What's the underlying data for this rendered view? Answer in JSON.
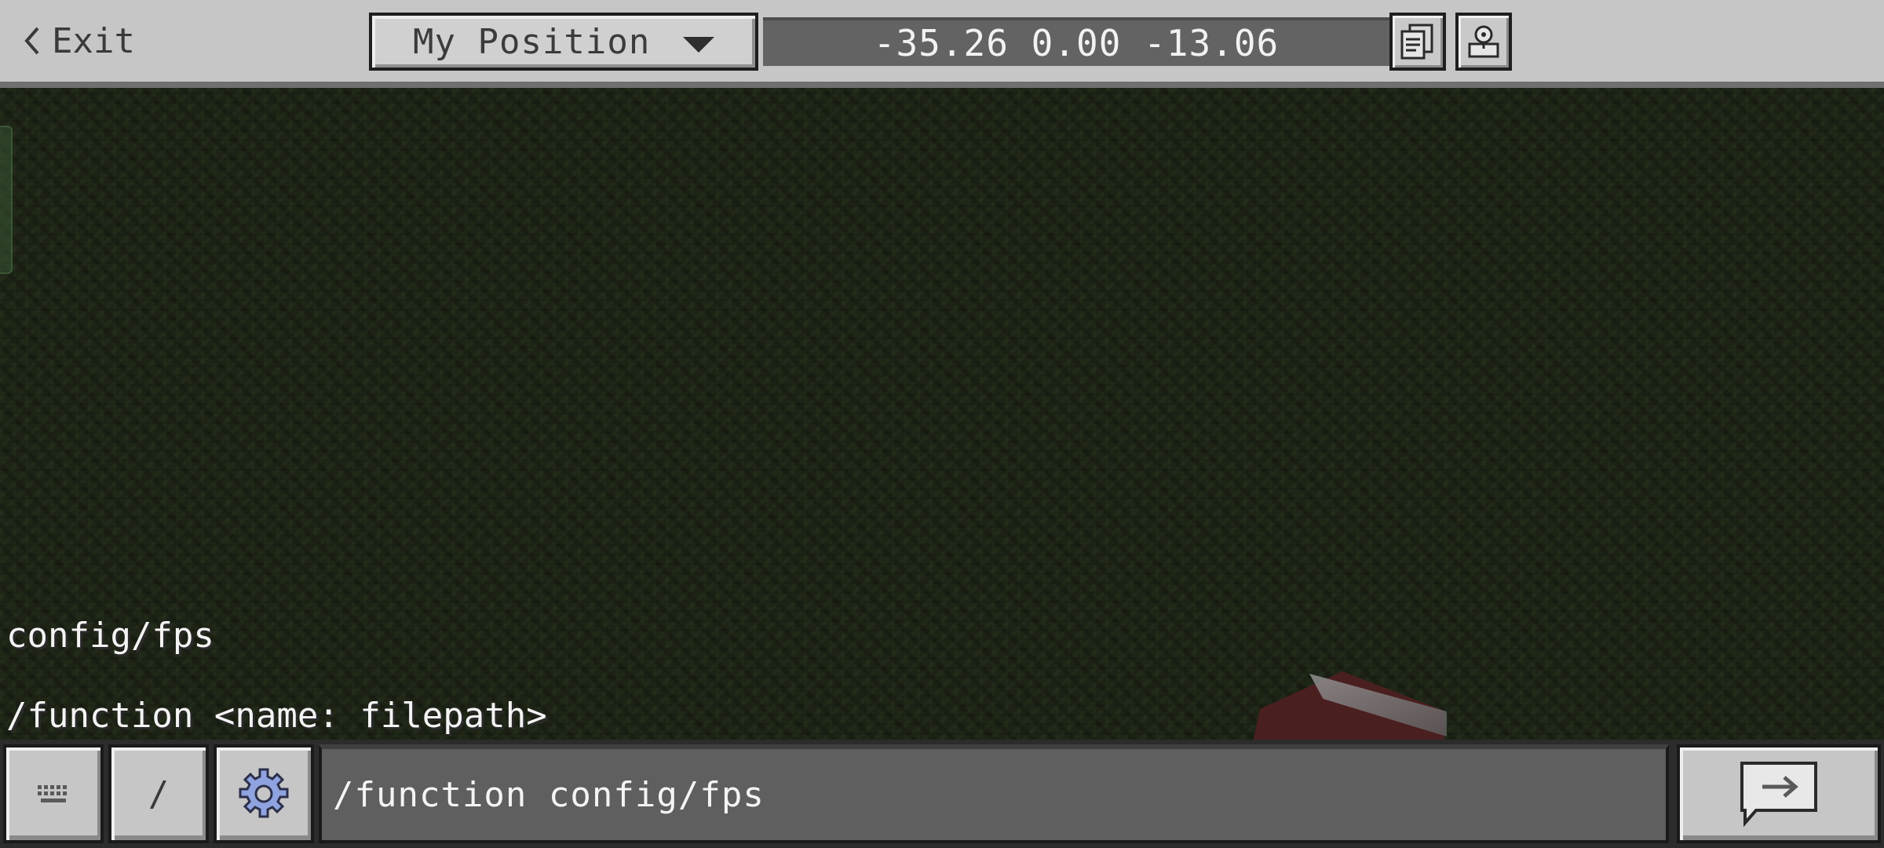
{
  "header": {
    "exit_label": "Exit",
    "position_dropdown": {
      "selected": "My Position"
    },
    "coordinates": "-35.26 0.00 -13.06"
  },
  "chat": {
    "lines": [
      "config/fps",
      "/function <name: filepath>"
    ]
  },
  "input": {
    "slash_label": "/",
    "value": "/function config/fps"
  },
  "icons": {
    "exit": "chevron-left-icon",
    "dropdown": "triangle-down-icon",
    "copy_coordinates": "copy-coordinates-icon",
    "teleport": "teleport-icon",
    "keyboard": "keyboard-icon",
    "settings": "gear-icon",
    "send": "send-arrow-speech-bubble-icon"
  },
  "colors": {
    "toolbar_gray": "#c6c6c6",
    "coords_background": "#636363",
    "input_background": "#5f5f5f",
    "settings_icon_blue": "#8fa3e0"
  }
}
